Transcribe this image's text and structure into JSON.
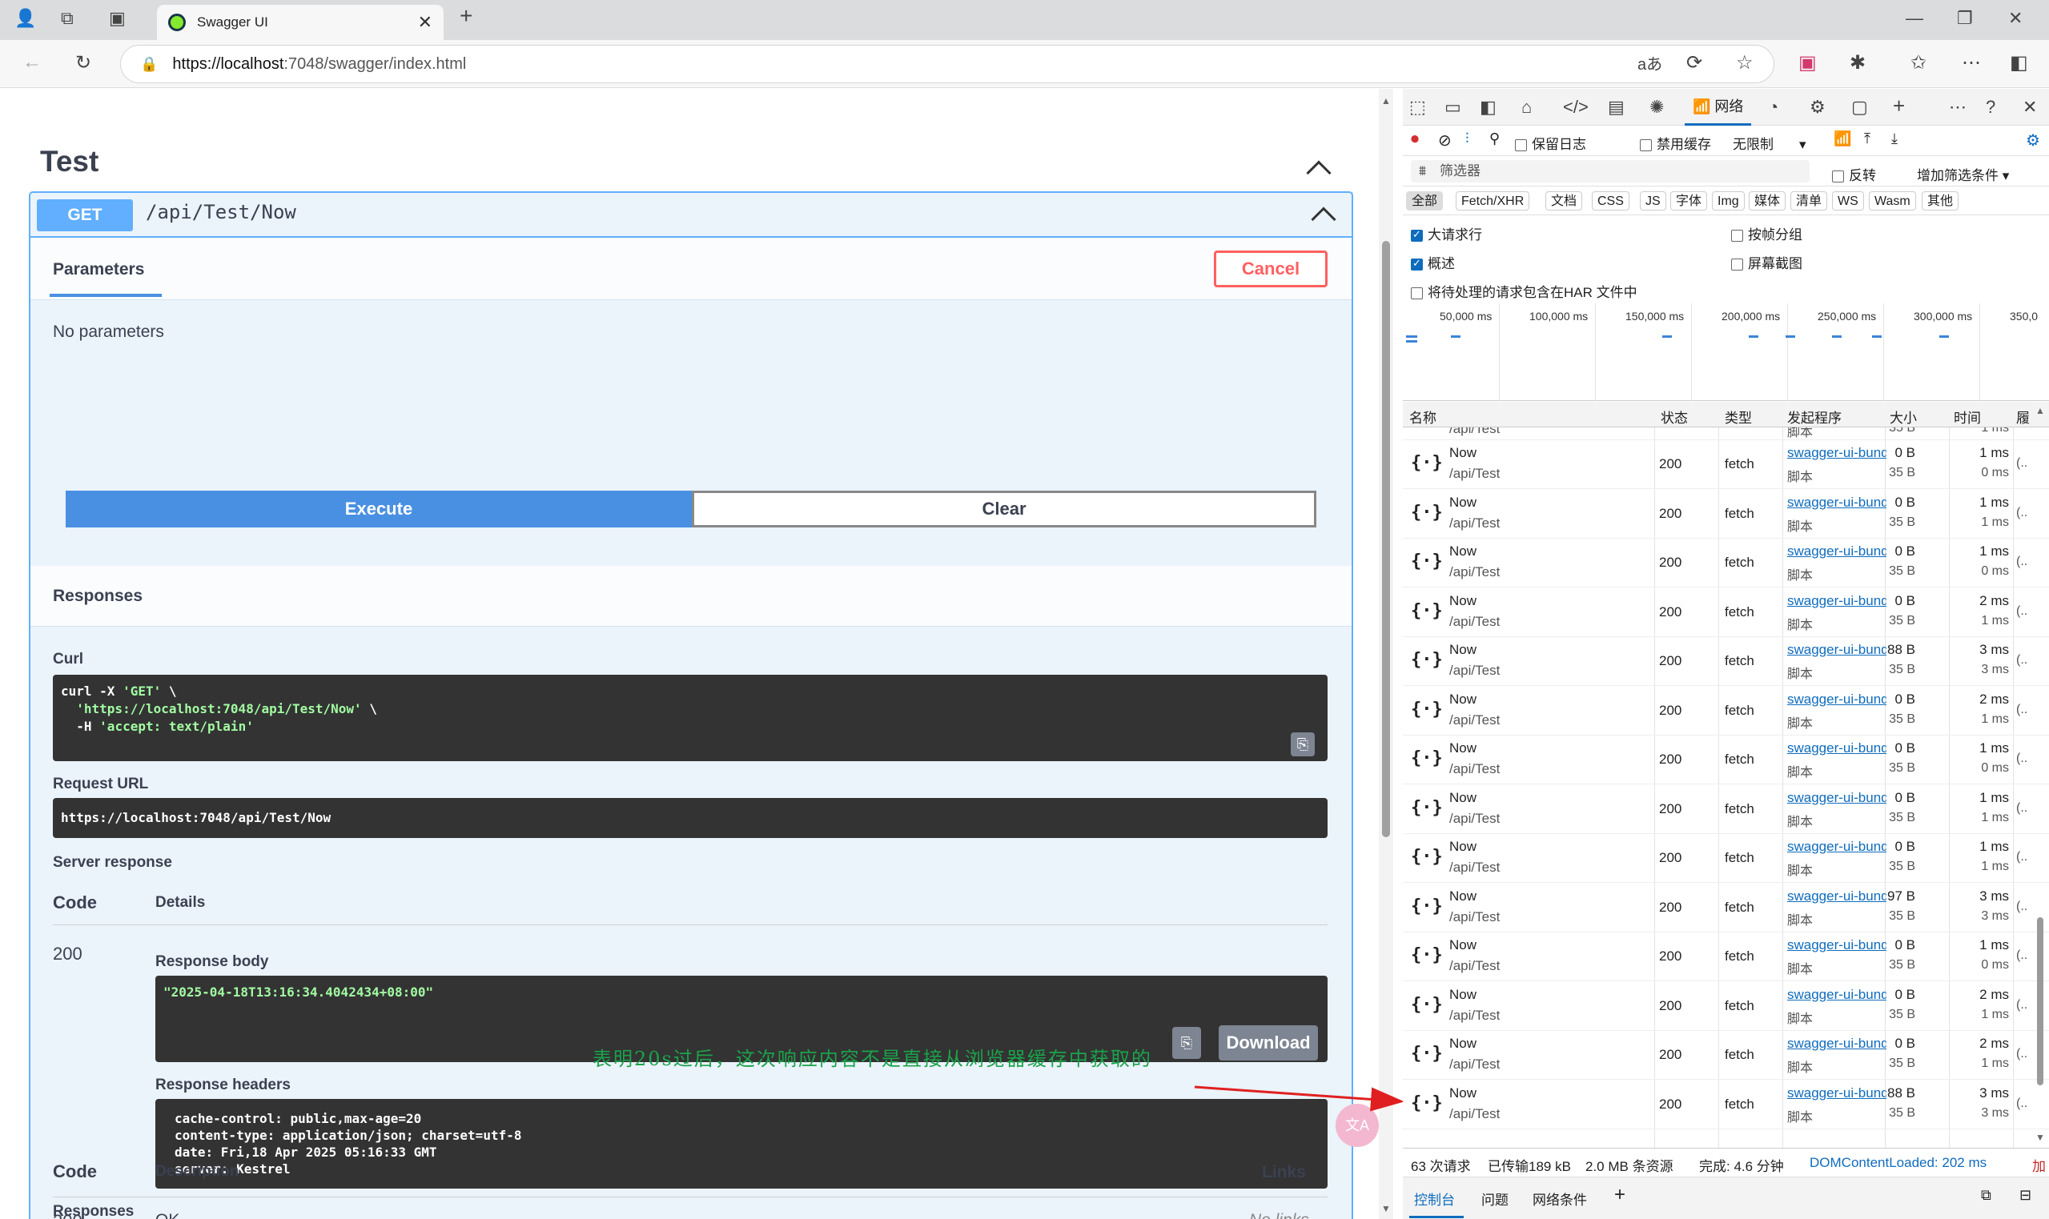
{
  "browser": {
    "tab_title": "Swagger UI",
    "url_host": "https://localhost",
    "url_rest": ":7048/swagger/index.html"
  },
  "swagger": {
    "section_title": "Test",
    "method": "GET",
    "path": "/api/Test/Now",
    "parameters_tab": "Parameters",
    "cancel_label": "Cancel",
    "no_params": "No parameters",
    "execute_label": "Execute",
    "clear_label": "Clear",
    "responses_title": "Responses",
    "curl_label": "Curl",
    "curl_line1": "curl -X ",
    "curl_line1_str": "'GET'",
    "curl_line1_end": " \\",
    "curl_line2": "  'https://localhost:7048/api/Test/Now'",
    "curl_line2_end": " \\",
    "curl_line3": "  -H ",
    "curl_line3_str": "'accept: text/plain'",
    "request_url_label": "Request URL",
    "request_url": "https://localhost:7048/api/Test/Now",
    "server_response_label": "Server response",
    "code_col": "Code",
    "details_col": "Details",
    "code_value": "200",
    "response_body_label": "Response body",
    "response_body": "\"2025-04-18T13:16:34.4042434+08:00\"",
    "download_label": "Download",
    "response_headers_label": "Response headers",
    "headers": [
      "cache-control: public,max-age=20",
      "content-type: application/json; charset=utf-8",
      "date: Fri,18 Apr 2025 05:16:33 GMT",
      "server: Kestrel"
    ],
    "annotation": "表明20s过后，这次响应内容不是直接从浏览器缓存中获取的",
    "responses2_title": "Responses",
    "code_col2": "Code",
    "description_col": "Description",
    "links_col": "Links",
    "partial_code": "200",
    "partial_desc": "OK",
    "partial_links": "No links",
    "translate_badge": "文A"
  },
  "devtools": {
    "network_tab": "网络",
    "preserve_log": "保留日志",
    "disable_cache": "禁用缓存",
    "throttle": "无限制",
    "filter_placeholder": "筛选器",
    "invert": "反转",
    "more_filters": "增加筛选条件",
    "chips": [
      "全部",
      "Fetch/XHR",
      "文档",
      "CSS",
      "JS",
      "字体",
      "Img",
      "媒体",
      "清单",
      "WS",
      "Wasm",
      "其他"
    ],
    "big_rows": "大请求行",
    "group_by_frame": "按帧分组",
    "overview": "概述",
    "screenshots": "屏幕截图",
    "har_option": "将待处理的请求包含在HAR 文件中",
    "timeline_labels": [
      "50,000 ms",
      "100,000 ms",
      "150,000 ms",
      "200,000 ms",
      "250,000 ms",
      "300,000 ms",
      "350,0"
    ],
    "columns": [
      "名称",
      "状态",
      "类型",
      "发起程序",
      "大小",
      "时间",
      "履"
    ],
    "partial_top_row": {
      "name2": "/api/Test",
      "initiator2": "脚本",
      "size2": "35 B",
      "time2": "1 ms"
    },
    "rows": [
      {
        "name": "Now",
        "path": "/api/Test",
        "status": "200",
        "type": "fetch",
        "initiator": "swagger-ui-bundle.js",
        "initiator_sub": "脚本",
        "size": "0 B",
        "size_sub": "35 B",
        "time": "1 ms",
        "time_sub": "0 ms",
        "waterfall": "(.."
      },
      {
        "name": "Now",
        "path": "/api/Test",
        "status": "200",
        "type": "fetch",
        "initiator": "swagger-ui-bundle.js",
        "initiator_sub": "脚本",
        "size": "0 B",
        "size_sub": "35 B",
        "time": "1 ms",
        "time_sub": "1 ms",
        "waterfall": "(.."
      },
      {
        "name": "Now",
        "path": "/api/Test",
        "status": "200",
        "type": "fetch",
        "initiator": "swagger-ui-bundle.js",
        "initiator_sub": "脚本",
        "size": "0 B",
        "size_sub": "35 B",
        "time": "1 ms",
        "time_sub": "0 ms",
        "waterfall": "(.."
      },
      {
        "name": "Now",
        "path": "/api/Test",
        "status": "200",
        "type": "fetch",
        "initiator": "swagger-ui-bundle.js",
        "initiator_sub": "脚本",
        "size": "0 B",
        "size_sub": "35 B",
        "time": "2 ms",
        "time_sub": "1 ms",
        "waterfall": "(.."
      },
      {
        "name": "Now",
        "path": "/api/Test",
        "status": "200",
        "type": "fetch",
        "initiator": "swagger-ui-bundle.js",
        "initiator_sub": "脚本",
        "size": "88 B",
        "size_sub": "35 B",
        "time": "3 ms",
        "time_sub": "3 ms",
        "waterfall": "(.."
      },
      {
        "name": "Now",
        "path": "/api/Test",
        "status": "200",
        "type": "fetch",
        "initiator": "swagger-ui-bundle.js",
        "initiator_sub": "脚本",
        "size": "0 B",
        "size_sub": "35 B",
        "time": "2 ms",
        "time_sub": "1 ms",
        "waterfall": "(.."
      },
      {
        "name": "Now",
        "path": "/api/Test",
        "status": "200",
        "type": "fetch",
        "initiator": "swagger-ui-bundle.js",
        "initiator_sub": "脚本",
        "size": "0 B",
        "size_sub": "35 B",
        "time": "1 ms",
        "time_sub": "0 ms",
        "waterfall": "(.."
      },
      {
        "name": "Now",
        "path": "/api/Test",
        "status": "200",
        "type": "fetch",
        "initiator": "swagger-ui-bundle.js",
        "initiator_sub": "脚本",
        "size": "0 B",
        "size_sub": "35 B",
        "time": "1 ms",
        "time_sub": "1 ms",
        "waterfall": "(.."
      },
      {
        "name": "Now",
        "path": "/api/Test",
        "status": "200",
        "type": "fetch",
        "initiator": "swagger-ui-bundle.js",
        "initiator_sub": "脚本",
        "size": "0 B",
        "size_sub": "35 B",
        "time": "1 ms",
        "time_sub": "1 ms",
        "waterfall": "(.."
      },
      {
        "name": "Now",
        "path": "/api/Test",
        "status": "200",
        "type": "fetch",
        "initiator": "swagger-ui-bundle.js",
        "initiator_sub": "脚本",
        "size": "97 B",
        "size_sub": "35 B",
        "time": "3 ms",
        "time_sub": "3 ms",
        "waterfall": "(.."
      },
      {
        "name": "Now",
        "path": "/api/Test",
        "status": "200",
        "type": "fetch",
        "initiator": "swagger-ui-bundle.js",
        "initiator_sub": "脚本",
        "size": "0 B",
        "size_sub": "35 B",
        "time": "1 ms",
        "time_sub": "0 ms",
        "waterfall": "(.."
      },
      {
        "name": "Now",
        "path": "/api/Test",
        "status": "200",
        "type": "fetch",
        "initiator": "swagger-ui-bundle.js",
        "initiator_sub": "脚本",
        "size": "0 B",
        "size_sub": "35 B",
        "time": "2 ms",
        "time_sub": "1 ms",
        "waterfall": "(.."
      },
      {
        "name": "Now",
        "path": "/api/Test",
        "status": "200",
        "type": "fetch",
        "initiator": "swagger-ui-bundle.js",
        "initiator_sub": "脚本",
        "size": "0 B",
        "size_sub": "35 B",
        "time": "2 ms",
        "time_sub": "1 ms",
        "waterfall": "(.."
      },
      {
        "name": "Now",
        "path": "/api/Test",
        "status": "200",
        "type": "fetch",
        "initiator": "swagger-ui-bundle.js",
        "initiator_sub": "脚本",
        "size": "88 B",
        "size_sub": "35 B",
        "time": "3 ms",
        "time_sub": "3 ms",
        "waterfall": "(.."
      }
    ],
    "status_requests": "63 次请求",
    "status_transferred": "已传输189 kB",
    "status_resources": "2.0 MB 条资源",
    "status_finish": "完成: 4.6 分钟",
    "status_dcl": "DOMContentLoaded: 202 ms",
    "status_load": "加",
    "drawer_console": "控制台",
    "drawer_issues": "问题",
    "drawer_network_conditions": "网络条件"
  },
  "colors": {
    "get_blue": "#61affe",
    "execute_blue": "#4990e2",
    "cancel_red": "#ff6060",
    "highlight_red": "#e02020",
    "annotation_green": "#1aa34a"
  }
}
